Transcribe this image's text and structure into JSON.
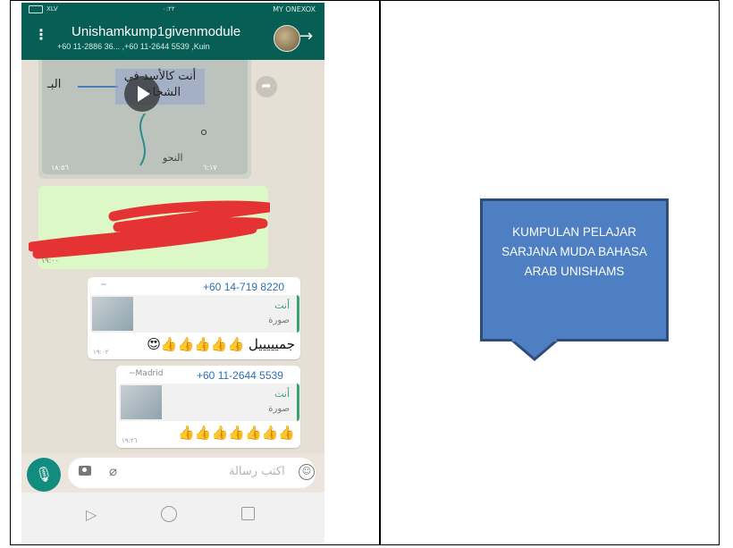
{
  "status_bar": {
    "left": "XLV",
    "time": "٠:٢٢",
    "carrier": "MY ONEXOX"
  },
  "chat_header": {
    "title": "Unishamkump1givenmodule",
    "participants": "+60 11-2886 36... ,+60 11-2644 5539 ,Kuin",
    "avatar_icon": "group-avatar",
    "menu_icon": "kebab-menu-icon",
    "back_icon": "arrow-right-icon"
  },
  "video_message": {
    "overlay_text": "أنت كالأسد في الشجاعة",
    "left_text": "البـ",
    "bottom_text": "النحو",
    "time_left": "١٨:٥٦",
    "duration": "٦:١٧"
  },
  "redacted_message": {
    "time": "١٩:٠٠"
  },
  "messages": [
    {
      "sender_name": "~",
      "sender_number": "+60 14-719 8220",
      "quote_author": "أنت",
      "quote_type": "صورة",
      "text": "جميييييل 👍👍👍👍👍😍",
      "time": "١٩:٠٢"
    },
    {
      "sender_name": "~Madrid",
      "sender_number": "+60 11-2644 5539",
      "quote_author": "أنت",
      "quote_type": "صورة",
      "text": "👍👍👍👍👍👍👍",
      "time": "١٩:٢٦"
    }
  ],
  "input": {
    "placeholder": "اكتب رسالة"
  },
  "callout": {
    "text": "KUMPULAN PELAJAR SARJANA MUDA BAHASA ARAB UNISHAMS",
    "fill_color": "#4f7fc3",
    "border_color": "#2e4d7a"
  },
  "colors": {
    "header": "#075e54",
    "outgoing_bubble": "#dcf8c6",
    "sender_number": "#2e6fb3",
    "mic_button": "#128c7e",
    "redaction": "#e53232"
  }
}
